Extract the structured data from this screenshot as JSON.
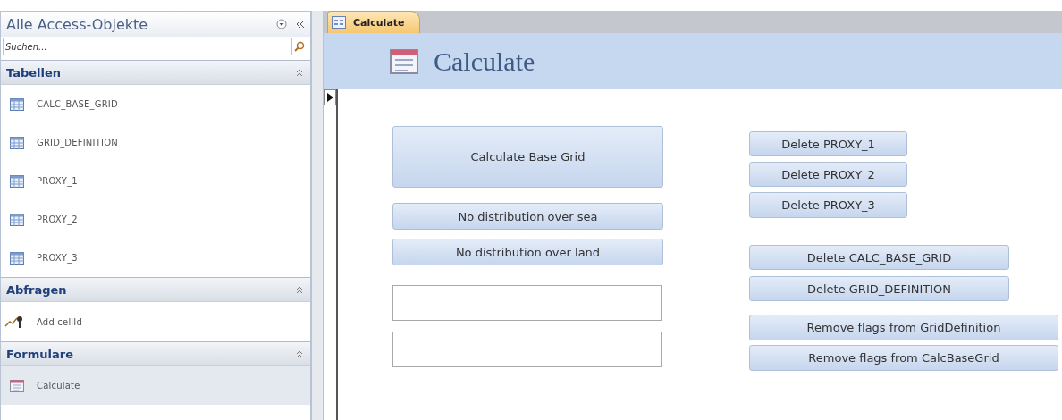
{
  "nav_pane": {
    "title": "Alle Access-Objekte",
    "search": {
      "placeholder": "Suchen..."
    },
    "groups": [
      {
        "label": "Tabellen",
        "expanded": true,
        "items": [
          {
            "label": "CALC_BASE_GRID",
            "kind": "table",
            "selected": false
          },
          {
            "label": "GRID_DEFINITION",
            "kind": "table",
            "selected": false
          },
          {
            "label": "PROXY_1",
            "kind": "table",
            "selected": false
          },
          {
            "label": "PROXY_2",
            "kind": "table",
            "selected": false
          },
          {
            "label": "PROXY_3",
            "kind": "table",
            "selected": false
          }
        ]
      },
      {
        "label": "Abfragen",
        "expanded": true,
        "items": [
          {
            "label": "Add cellId",
            "kind": "query",
            "selected": false
          }
        ]
      },
      {
        "label": "Formulare",
        "expanded": true,
        "items": [
          {
            "label": "Calculate",
            "kind": "form",
            "selected": true
          }
        ]
      }
    ]
  },
  "tabs": [
    {
      "label": "Calculate",
      "selected": true
    }
  ],
  "form": {
    "title": "Calculate",
    "controls": [
      {
        "kind": "button",
        "label": "Calculate Base Grid"
      },
      {
        "kind": "button",
        "label": "No distribution over sea"
      },
      {
        "kind": "button",
        "label": "No distribution over land"
      },
      {
        "kind": "textbox"
      },
      {
        "kind": "textbox"
      },
      {
        "kind": "button",
        "label": "Delete PROXY_1"
      },
      {
        "kind": "button",
        "label": "Delete PROXY_2"
      },
      {
        "kind": "button",
        "label": "Delete PROXY_3"
      },
      {
        "kind": "button",
        "label": "Delete CALC_BASE_GRID"
      },
      {
        "kind": "button",
        "label": "Delete GRID_DEFINITION"
      },
      {
        "kind": "button",
        "label": "Remove flags from GridDefinition"
      },
      {
        "kind": "button",
        "label": "Remove flags from CalcBaseGrid"
      }
    ]
  }
}
